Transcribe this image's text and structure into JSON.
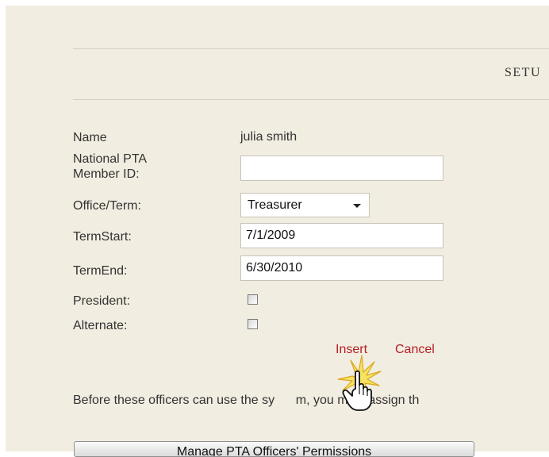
{
  "section": {
    "title": "SETU"
  },
  "form": {
    "name_label": "Name",
    "name_value": "julia smith",
    "member_id_label": "National PTA\nMember ID:",
    "member_id_value": "",
    "office_label": "Office/Term:",
    "office_value": "Treasurer",
    "term_start_label": "TermStart:",
    "term_start_value": "7/1/2009",
    "term_end_label": "TermEnd:",
    "term_end_value": "6/30/2010",
    "president_label": "President:",
    "president_checked": false,
    "alternate_label": "Alternate:",
    "alternate_checked": false
  },
  "actions": {
    "insert_label": "Insert",
    "cancel_label": "Cancel"
  },
  "message": "Before these officers can use the sy      m, you must assign th",
  "permissions_button_label": "Manage PTA Officers' Permissions",
  "colors": {
    "background": "#f2ede1",
    "link": "#b31f24",
    "text": "#333333"
  },
  "icons": {
    "cursor": "hand-pointer-icon",
    "click": "click-burst-icon"
  }
}
